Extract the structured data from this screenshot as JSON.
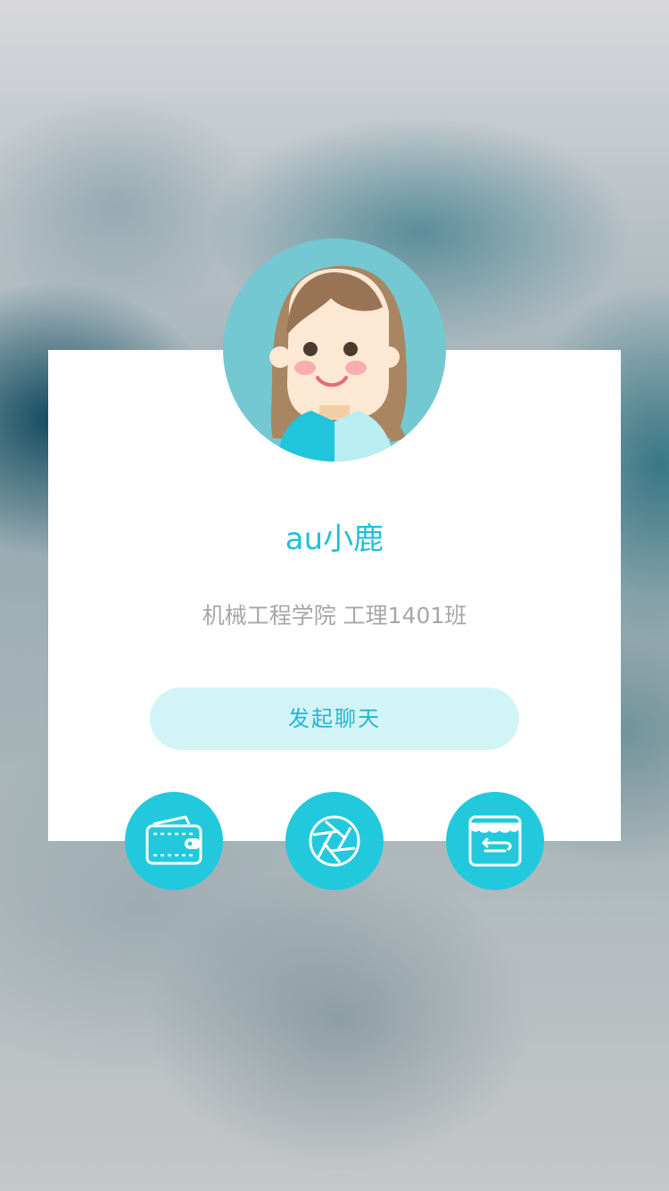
{
  "profile": {
    "name": "au小鹿",
    "school": "机械工程学院  工理1401班"
  },
  "actions": {
    "chat_label": "发起聊天",
    "icons": [
      "wallet-icon",
      "aperture-icon",
      "shop-icon"
    ]
  },
  "colors": {
    "accent": "#22c9dd",
    "name_text": "#1fc0d7",
    "button_bg": "#d3f4f7",
    "secondary_text": "#a7a7a7",
    "card_bg": "#ffffff"
  }
}
